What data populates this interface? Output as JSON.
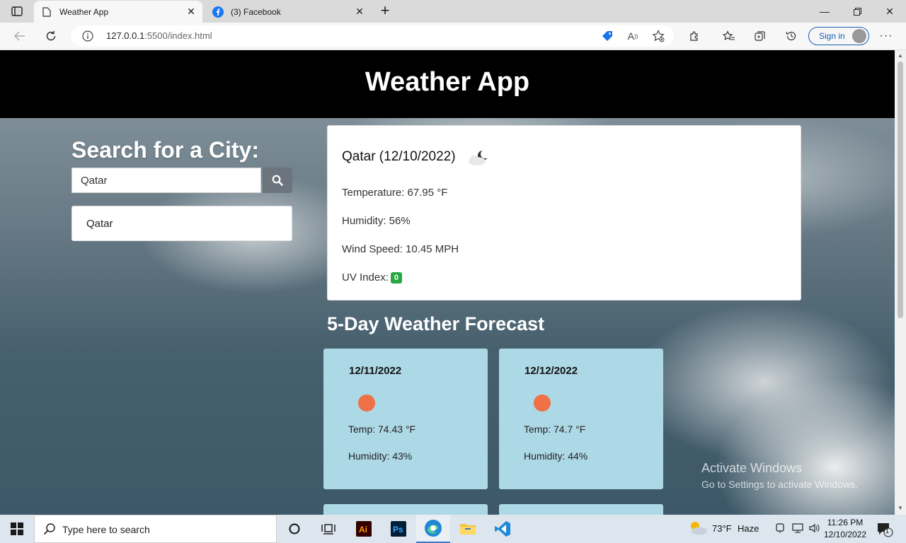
{
  "browser": {
    "tabs": [
      {
        "title": "Weather App",
        "active": true
      },
      {
        "title": "(3) Facebook",
        "active": false
      }
    ],
    "url_host": "127.0.0.1",
    "url_rest": ":5500/index.html",
    "signin_label": "Sign in"
  },
  "app": {
    "title": "Weather App",
    "search_heading": "Search for a City:",
    "search_value": "Qatar",
    "history": [
      "Qatar"
    ]
  },
  "current": {
    "heading": "Qatar (12/10/2022)",
    "icon": "partly-cloudy-night-icon",
    "temperature": "Temperature: 67.95 °F",
    "humidity": "Humidity: 56%",
    "wind": "Wind Speed: 10.45 MPH",
    "uv_label": "UV Index:",
    "uv_value": "0",
    "uv_color": "#28a745"
  },
  "forecast": {
    "heading": "5-Day Weather Forecast",
    "days": [
      {
        "date": "12/11/2022",
        "icon": "clear-sun-icon",
        "temp": "Temp: 74.43 °F",
        "humidity": "Humidity: 43%"
      },
      {
        "date": "12/12/2022",
        "icon": "clear-sun-icon",
        "temp": "Temp: 74.7 °F",
        "humidity": "Humidity: 44%"
      }
    ],
    "card_color": "#add8e6"
  },
  "watermark": {
    "line1": "Activate Windows",
    "line2": "Go to Settings to activate Windows."
  },
  "taskbar": {
    "search_placeholder": "Type here to search",
    "weather_temp": "73°F",
    "weather_cond": "Haze",
    "time": "11:26 PM",
    "date": "12/10/2022",
    "notification_count": "1"
  }
}
